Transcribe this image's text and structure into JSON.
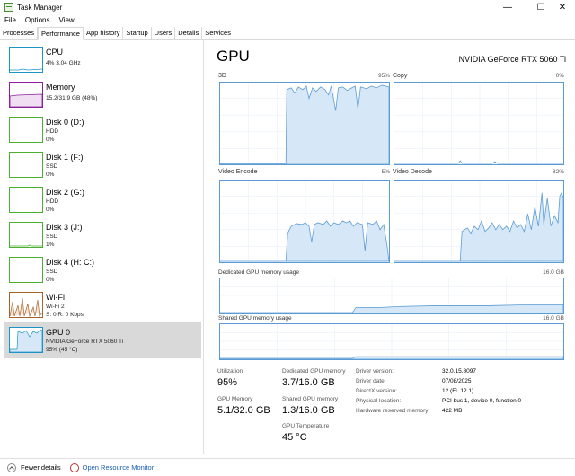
{
  "window": {
    "title": "Task Manager",
    "minimize": "—",
    "maximize": "☐",
    "close": "✕"
  },
  "menu": [
    "File",
    "Options",
    "View"
  ],
  "tabs": [
    "Processes",
    "Performance",
    "App history",
    "Startup",
    "Users",
    "Details",
    "Services"
  ],
  "sidebar": [
    {
      "name": "CPU",
      "sub1": "4% 3.04 GHz",
      "sub2": "",
      "sub3": "",
      "color": "#1b95c8"
    },
    {
      "name": "Memory",
      "sub1": "15.2/31.9 GB (48%)",
      "sub2": "",
      "sub3": "",
      "color": "#8b1e9b"
    },
    {
      "name": "Disk 0 (D:)",
      "sub1": "HDD",
      "sub2": "0%",
      "sub3": "",
      "color": "#4daf30"
    },
    {
      "name": "Disk 1 (F:)",
      "sub1": "SSD",
      "sub2": "0%",
      "sub3": "",
      "color": "#4daf30"
    },
    {
      "name": "Disk 2 (G:)",
      "sub1": "HDD",
      "sub2": "0%",
      "sub3": "",
      "color": "#4daf30"
    },
    {
      "name": "Disk 3 (J:)",
      "sub1": "SSD",
      "sub2": "1%",
      "sub3": "",
      "color": "#4daf30"
    },
    {
      "name": "Disk 4 (H: C:)",
      "sub1": "SSD",
      "sub2": "0%",
      "sub3": "",
      "color": "#4daf30"
    },
    {
      "name": "Wi-Fi",
      "sub1": "Wi-Fi 2",
      "sub2": "S: 0 R: 0 Kbps",
      "sub3": "",
      "color": "#a7642a"
    },
    {
      "name": "GPU 0",
      "sub1": "NVIDIA GeForce RTX 5060 Ti",
      "sub2": "95% (45 °C)",
      "sub3": "",
      "color": "#1b95c8"
    }
  ],
  "main": {
    "title": "GPU",
    "model": "NVIDIA GeForce RTX 5060 Ti",
    "graphs": [
      {
        "label": "3D",
        "pct": "95%"
      },
      {
        "label": "Copy",
        "pct": "0%"
      },
      {
        "label": "Video Encode",
        "pct": "5%"
      },
      {
        "label": "Video Decode",
        "pct": "82%"
      }
    ],
    "dedicated_label": "Dedicated GPU memory usage",
    "dedicated_max": "16.0 GB",
    "shared_label": "Shared GPU memory usage",
    "shared_max": "16.0 GB",
    "stats": {
      "utilization_label": "Utilization",
      "utilization": "95%",
      "dedicated_label": "Dedicated GPU memory",
      "dedicated": "3.7/16.0 GB",
      "gpu_memory_label": "GPU Memory",
      "gpu_memory": "5.1/32.0 GB",
      "shared_label": "Shared GPU memory",
      "shared": "1.3/16.0 GB",
      "temp_label": "GPU Temperature",
      "temp": "45 °C"
    },
    "info": [
      {
        "label": "Driver version:",
        "value": "32.0.15.8097"
      },
      {
        "label": "Driver date:",
        "value": "07/08/2025"
      },
      {
        "label": "DirectX version:",
        "value": "12 (FL 12.1)"
      },
      {
        "label": "Physical location:",
        "value": "PCI bus 1, device 0, function 0"
      },
      {
        "label": "Hardware reserved memory:",
        "value": "422 MB"
      }
    ]
  },
  "footer": {
    "fewer": "Fewer details",
    "resmon": "Open Resource Monitor"
  },
  "colors": {
    "accent": "#5b9bd5",
    "graph_fill": "#d6e8f7",
    "selected": "#d9d9d9"
  }
}
